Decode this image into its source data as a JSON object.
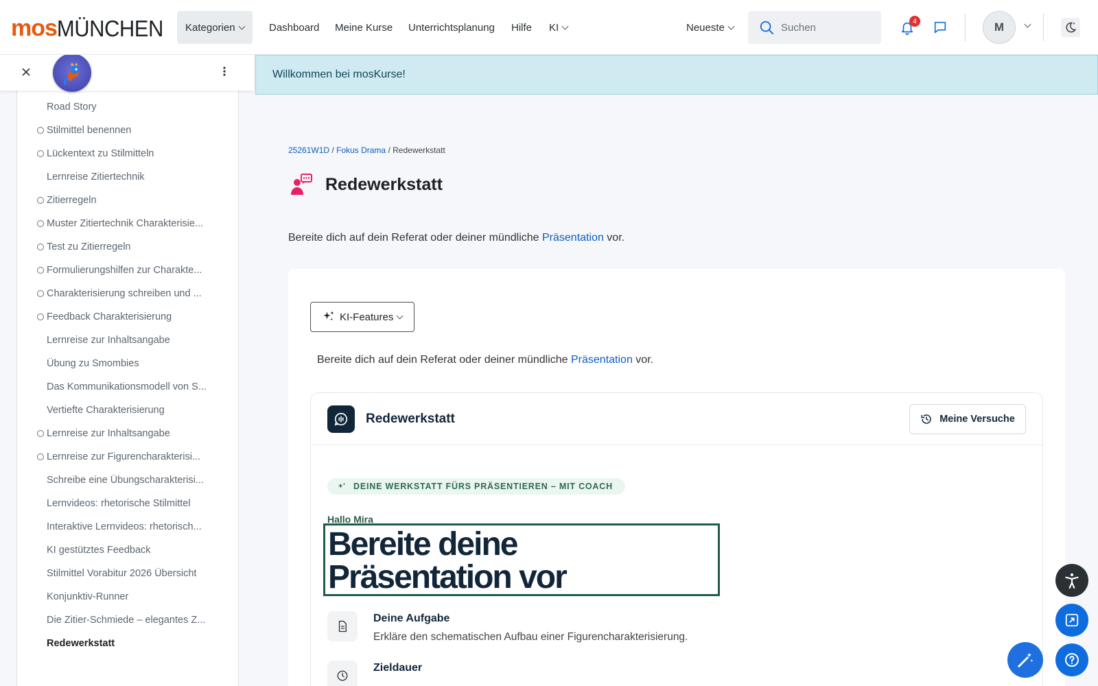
{
  "brand": {
    "mos": "mos",
    "city": "MÜNCHEN"
  },
  "nav": {
    "categories": "Kategorien",
    "dashboard": "Dashboard",
    "my_courses": "Meine Kurse",
    "planning": "Unterrichtsplanung",
    "help": "Hilfe",
    "ki": "KI",
    "newest": "Neueste",
    "search_placeholder": "Suchen",
    "notif_count": "4",
    "avatar_initial": "M"
  },
  "colors": {
    "brand_orange": "#e8590c",
    "link": "#0f5cc0",
    "primary_blue": "#0f6cde",
    "dark_navy": "#12263a",
    "pink_accent": "#e91e63"
  },
  "sidebar": {
    "items": [
      {
        "label": "Road Story",
        "circle": false
      },
      {
        "label": "Stilmittel benennen",
        "circle": true
      },
      {
        "label": "Lückentext zu Stilmitteln",
        "circle": true
      },
      {
        "label": "Lernreise Zitiertechnik",
        "circle": false
      },
      {
        "label": "Zitierregeln",
        "circle": true
      },
      {
        "label": "Muster Zitiertechnik Charakterisie...",
        "circle": true
      },
      {
        "label": "Test zu Zitierregeln",
        "circle": true
      },
      {
        "label": "Formulierungshilfen zur Charakte...",
        "circle": true
      },
      {
        "label": "Charakterisierung schreiben und ...",
        "circle": true
      },
      {
        "label": "Feedback Charakterisierung",
        "circle": true
      },
      {
        "label": "Lernreise zur Inhaltsangabe",
        "circle": false
      },
      {
        "label": "Übung zu Smombies",
        "circle": false
      },
      {
        "label": "Das Kommunikationsmodell von S...",
        "circle": false
      },
      {
        "label": "Vertiefte Charakterisierung",
        "circle": false
      },
      {
        "label": "Lernreise zur Inhaltsangabe",
        "circle": true
      },
      {
        "label": "Lernreise zur Figurencharakterisi...",
        "circle": true
      },
      {
        "label": "Schreibe eine Übungscharakterisi...",
        "circle": false
      },
      {
        "label": "Lernvideos: rhetorische Stilmittel",
        "circle": false
      },
      {
        "label": "Interaktive Lernvideos: rhetorisch...",
        "circle": false
      },
      {
        "label": "KI gestütztes Feedback",
        "circle": false
      },
      {
        "label": "Stilmittel Vorabitur 2026 Übersicht",
        "circle": false
      },
      {
        "label": "Konjunktiv-Runner",
        "circle": false
      },
      {
        "label": "Die Zitier-Schmiede – elegantes Z...",
        "circle": false
      },
      {
        "label": "Redewerkstatt",
        "circle": false,
        "current": true
      }
    ]
  },
  "alert": "Willkommen bei mosKurse!",
  "breadcrumb": {
    "course": "25261W1D",
    "section": "Fokus Drama",
    "current": "Redewerkstatt",
    "sep": "/"
  },
  "page": {
    "title": "Redewerkstatt",
    "intro_before": "Bereite dich auf dein Referat oder deiner mündliche ",
    "intro_link": "Präsentation",
    "intro_after": " vor."
  },
  "ki_features": "KI-Features",
  "tool": {
    "title": "Redewerkstatt",
    "attempts": "Meine Versuche",
    "pill": "DEINE WERKSTATT FÜRS PRÄSENTIEREN – MIT COACH",
    "hello": "Hallo Mira",
    "hero_line1": "Bereite deine",
    "hero_line2": "Präsentation vor",
    "task_label": "Deine Aufgabe",
    "task_text": "Erkläre den schematischen Aufbau einer Figurencharakterisierung.",
    "duration_label": "Zieldauer"
  }
}
